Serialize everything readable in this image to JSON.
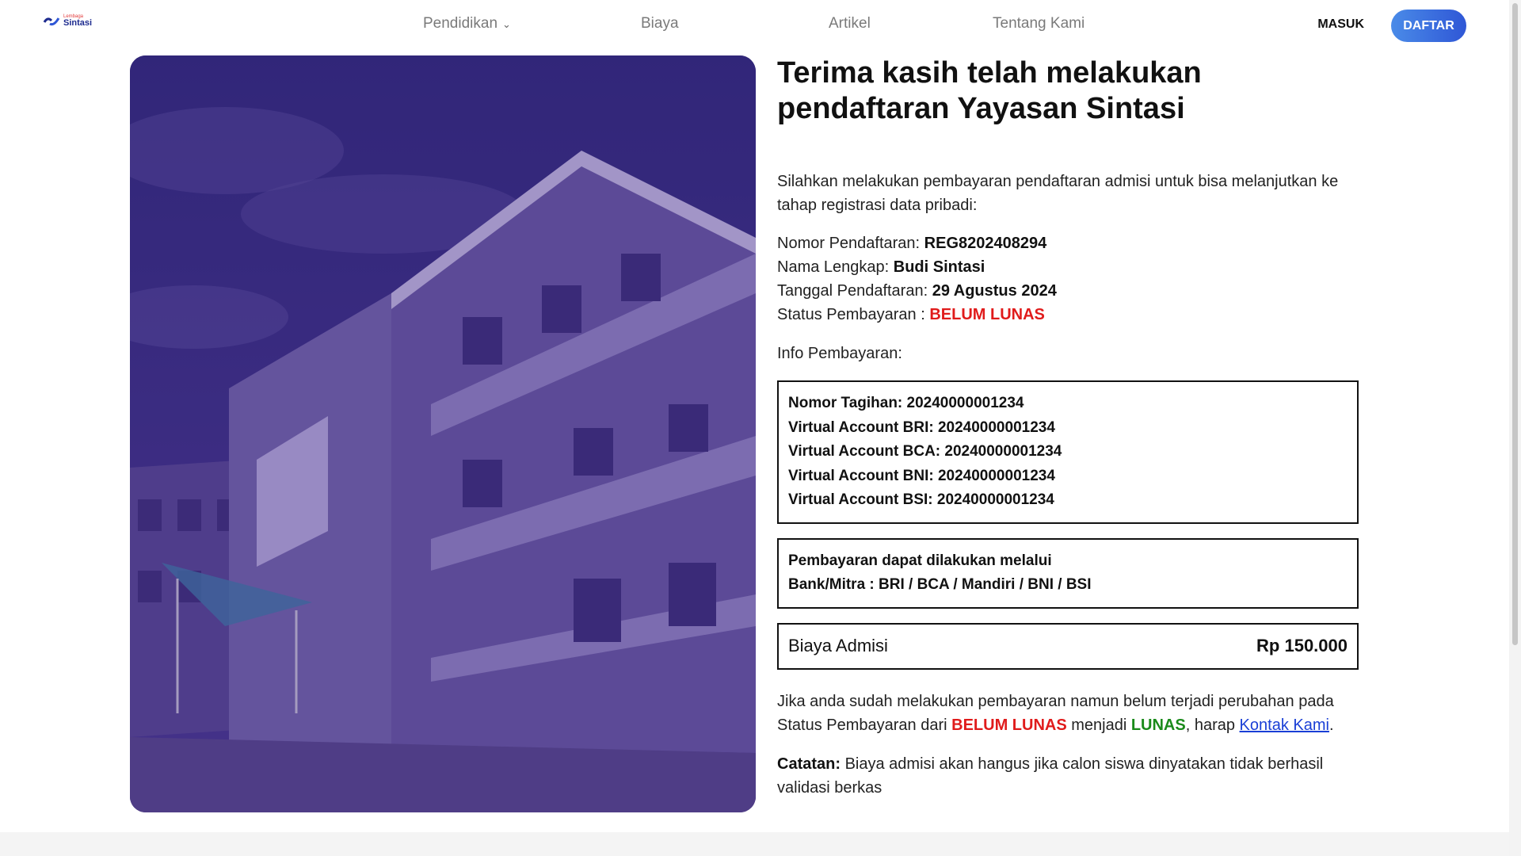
{
  "header": {
    "logo_small": "Lembaga",
    "logo_name": "Sintasi",
    "nav": [
      {
        "label": "Pendidikan",
        "has_dropdown": true
      },
      {
        "label": "Biaya"
      },
      {
        "label": "Artikel"
      },
      {
        "label": "Tentang Kami"
      }
    ],
    "login_label": "MASUK",
    "register_label": "DAFTAR"
  },
  "main": {
    "title": "Terima kasih telah melakukan pendaftaran Yayasan Sintasi",
    "intro": "Silahkan melakukan pembayaran pendaftaran admisi untuk bisa melanjutkan ke tahap registrasi data pribadi:",
    "details": {
      "reg_label": "Nomor Pendaftaran: ",
      "reg_value": "REG8202408294",
      "name_label": "Nama Lengkap: ",
      "name_value": "Budi Sintasi",
      "date_label": "Tanggal Pendaftaran: ",
      "date_value": "29 Agustus 2024",
      "status_label": "Status Pembayaran : ",
      "status_value": "BELUM LUNAS"
    },
    "payment_info_label": "Info Pembayaran:",
    "payment_lines": [
      "Nomor Tagihan: 20240000001234",
      "Virtual Account BRI: 20240000001234",
      "Virtual Account BCA: 20240000001234",
      "Virtual Account BNI: 20240000001234",
      "Virtual Account BSI: 20240000001234"
    ],
    "channel_title": "Pembayaran dapat dilakukan melalui",
    "channel_list": "Bank/Mitra : BRI / BCA / Mandiri / BNI / BSI",
    "fee_label": "Biaya Admisi",
    "fee_value": "Rp 150.000",
    "note": {
      "part1": "Jika anda sudah melakukan pembayaran namun belum terjadi perubahan pada Status Pembayaran dari ",
      "unpaid": "BELUM LUNAS",
      "part2": " menjadi ",
      "paid": "LUNAS",
      "part3": ", harap ",
      "contact_link": "Kontak Kami",
      "part4": "."
    },
    "catatan_label": "Catatan:",
    "catatan_text": " Biaya admisi akan hangus jika calon siswa dinyatakan tidak berhasil validasi berkas"
  },
  "colors": {
    "status_unpaid": "#e01b1b",
    "status_paid": "#1a8a1a",
    "primary": "#2f57d6",
    "hero_overlay": "#3b2f7c"
  }
}
